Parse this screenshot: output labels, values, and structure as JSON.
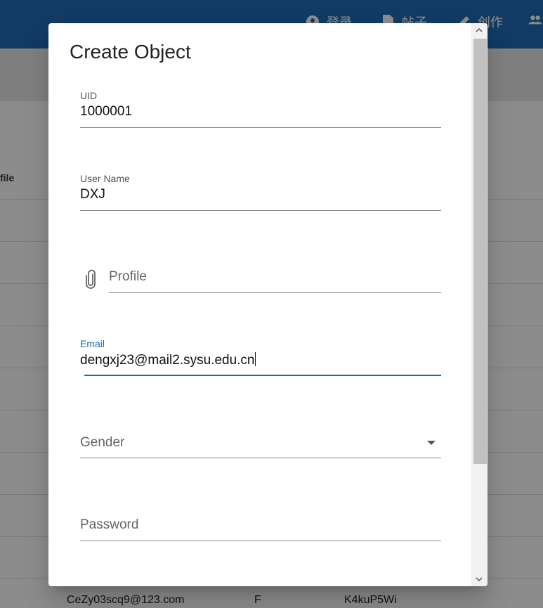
{
  "nav": {
    "items": [
      {
        "icon": "account-circle-icon",
        "label": "登录"
      },
      {
        "icon": "document-icon",
        "label": "帖子"
      },
      {
        "icon": "pencil-icon",
        "label": "创作"
      },
      {
        "icon": "group-icon",
        "label": ""
      }
    ]
  },
  "background_table": {
    "column_header": "file",
    "visible_row": {
      "email": "CeZy03scq9@123.com",
      "gender": "F",
      "password": "K4kuP5Wi"
    }
  },
  "dialog": {
    "title": "Create Object",
    "fields": {
      "uid": {
        "label": "UID",
        "value": "1000001"
      },
      "username": {
        "label": "User Name",
        "value": "DXJ"
      },
      "profile": {
        "placeholder": "Profile"
      },
      "email": {
        "label": "Email",
        "value": "dengxj23@mail2.sysu.edu.cn"
      },
      "gender": {
        "placeholder": "Gender"
      },
      "password": {
        "placeholder": "Password"
      }
    }
  },
  "colors": {
    "primary": "#1f6ab6"
  }
}
